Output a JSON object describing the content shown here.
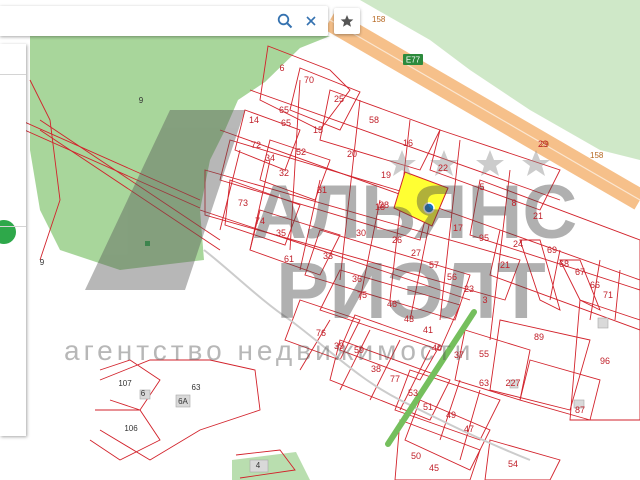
{
  "search": {
    "value": "",
    "placeholder": ""
  },
  "colors": {
    "forest": "#a8d69b",
    "road": "#f6c08a",
    "parcel": "#d2222b",
    "highlight": "#ffff33",
    "marker": "#1673c2",
    "accent": "#2ea84a"
  },
  "icons": {
    "search": "search-icon",
    "clear": "close-icon",
    "favorite": "star-icon"
  },
  "map": {
    "route_label": "E77",
    "road_numbers": [
      "158",
      "158",
      "29"
    ],
    "watermark_line1": "АЛЬЯНС",
    "watermark_line2": "РИЭЛТ",
    "watermark_tagline": "агентство недвижимости",
    "parcels": [
      "6",
      "70",
      "25",
      "65",
      "65",
      "58",
      "16",
      "14",
      "15",
      "72",
      "34",
      "32",
      "52",
      "20",
      "22",
      "19",
      "18",
      "5",
      "29",
      "31",
      "73",
      "74",
      "35",
      "61",
      "33",
      "30",
      "28",
      "26",
      "27",
      "57",
      "56",
      "23",
      "17",
      "95",
      "8",
      "21",
      "24",
      "69",
      "68",
      "67",
      "66",
      "71",
      "21",
      "36",
      "75",
      "46",
      "43",
      "41",
      "40",
      "37",
      "55",
      "63",
      "227",
      "76",
      "39",
      "59",
      "38",
      "77",
      "53",
      "51",
      "49",
      "47",
      "50",
      "45",
      "54",
      "89",
      "96",
      "87",
      "3",
      "107",
      "63",
      "6",
      "6A",
      "106",
      "4",
      "9",
      "9"
    ]
  }
}
